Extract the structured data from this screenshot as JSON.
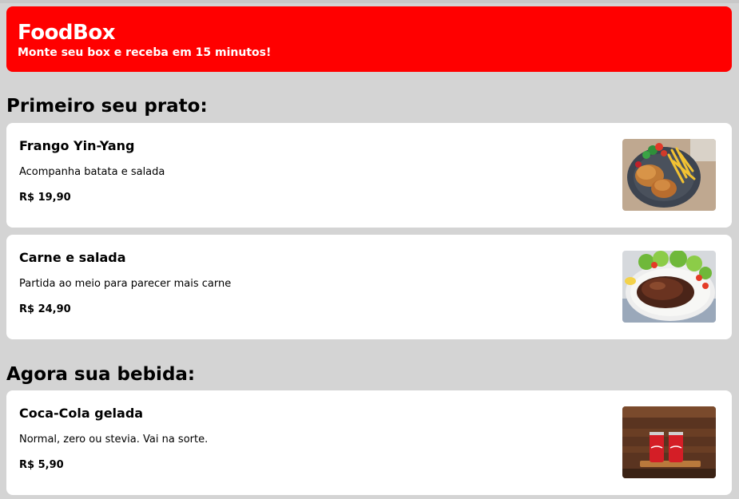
{
  "header": {
    "brand": "FoodBox",
    "tagline": "Monte seu box e receba em 15 minutos!",
    "color": "#ff0000"
  },
  "sections": [
    {
      "title": "Primeiro seu prato:",
      "items": [
        {
          "name": "Frango Yin-Yang",
          "description": "Acompanha batata e salada",
          "price": "R$ 19,90",
          "image": "chicken-fries-salad-plate"
        },
        {
          "name": "Carne e salada",
          "description": "Partida ao meio para parecer mais carne",
          "price": "R$ 24,90",
          "image": "grilled-meat-salad-plate"
        }
      ]
    },
    {
      "title": "Agora sua bebida:",
      "items": [
        {
          "name": "Coca-Cola gelada",
          "description": "Normal, zero ou stevia. Vai na sorte.",
          "price": "R$ 5,90",
          "image": "two-soda-cans"
        }
      ]
    }
  ]
}
